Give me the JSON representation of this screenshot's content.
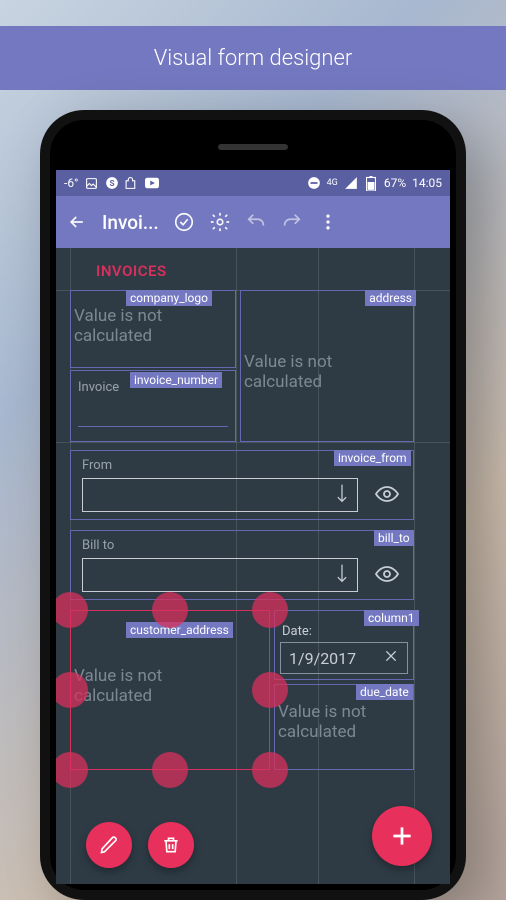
{
  "promo": {
    "title": "Visual form designer"
  },
  "status": {
    "temp": "-6°",
    "battery": "67%",
    "time": "14:05",
    "net": "4G"
  },
  "appbar": {
    "title": "Invoi..."
  },
  "form": {
    "section_title": "INVOICES",
    "not_calc": "Value is not calculated",
    "invoice_label": "Invoice",
    "from_label": "From",
    "billto_label": "Bill to",
    "date_label": "Date:",
    "date_value": "1/9/2017",
    "tags": {
      "company_logo": "company_logo",
      "address": "address",
      "invoice_number": "invoice_number",
      "invoice_from": "invoice_from",
      "bill_to": "bill_to",
      "customer_address": "customer_address",
      "column1": "column1",
      "due_date": "due_date"
    }
  }
}
